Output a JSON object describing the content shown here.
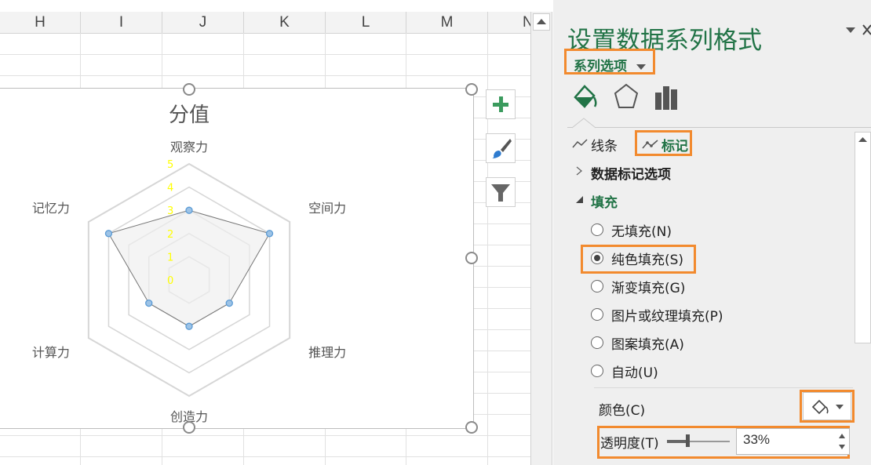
{
  "sheet": {
    "columns": [
      "H",
      "I",
      "J",
      "K",
      "L",
      "M",
      "N"
    ]
  },
  "chart": {
    "title": "分值",
    "axes": [
      "观察力",
      "空间力",
      "推理力",
      "创造力",
      "计算力",
      "记忆力"
    ],
    "ticks": [
      "0",
      "1",
      "2",
      "3",
      "4",
      "5"
    ],
    "tick_color": "#ffff00",
    "series_fill": "#eeeeee",
    "marker_color": "#5b9bd5"
  },
  "chart_data": {
    "type": "radar",
    "title": "分值",
    "categories": [
      "观察力",
      "空间力",
      "推理力",
      "创造力",
      "计算力",
      "记忆力"
    ],
    "series": [
      {
        "values": [
          3,
          4,
          2,
          2,
          2,
          4
        ]
      }
    ],
    "rlim": [
      0,
      5
    ],
    "ticks": [
      0,
      1,
      2,
      3,
      4,
      5
    ],
    "grid": true
  },
  "pane": {
    "title": "设置数据系列格式",
    "series_options": "系列选项",
    "accent": "#217346",
    "highlight": "#f28a2e",
    "tabs": [
      "paint-bucket-icon",
      "pentagon-icon",
      "bar-chart-icon"
    ],
    "subtabs": {
      "line": "线条",
      "marker": "标记"
    },
    "sections": {
      "marker_options": "数据标记选项",
      "fill": "填充"
    },
    "fill_options": [
      {
        "label": "无填充(N)",
        "selected": false
      },
      {
        "label": "纯色填充(S)",
        "selected": true
      },
      {
        "label": "渐变填充(G)",
        "selected": false
      },
      {
        "label": "图片或纹理填充(P)",
        "selected": false
      },
      {
        "label": "图案填充(A)",
        "selected": false
      },
      {
        "label": "自动(U)",
        "selected": false
      }
    ],
    "color_label": "颜色(C)",
    "transparency_label": "透明度(T)",
    "transparency_value": "33%",
    "transparency_fraction": 0.33
  }
}
